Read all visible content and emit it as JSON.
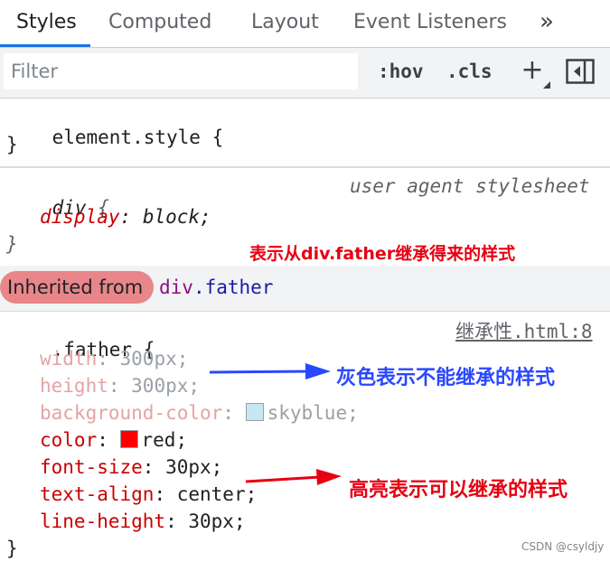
{
  "tabs": [
    {
      "label": "Styles",
      "active": true
    },
    {
      "label": "Computed",
      "active": false
    },
    {
      "label": "Layout",
      "active": false
    },
    {
      "label": "Event Listeners",
      "active": false
    }
  ],
  "more_tabs_icon": "»",
  "toolbar": {
    "filter_placeholder": "Filter",
    "hov_label": ":hov",
    "cls_label": ".cls",
    "new_rule_icon": "+",
    "toggle_sidebar_icon": "sidebar-toggle-icon"
  },
  "element_style": {
    "selector": "element.style",
    "open_brace": "{",
    "close_brace": "}"
  },
  "div_rule": {
    "selector": "div",
    "open_brace": "{",
    "source": "user agent stylesheet",
    "property": "display",
    "value": "block",
    "close_brace": "}"
  },
  "inherited": {
    "label": "Inherited from",
    "tag": "div",
    "class": ".father"
  },
  "father_rule": {
    "selector": ".father",
    "open_brace": "{",
    "source": "继承性.html:8",
    "close_brace": "}",
    "declarations": [
      {
        "property": "width",
        "value": "300px",
        "inherited": false
      },
      {
        "property": "height",
        "value": "300px",
        "inherited": false
      },
      {
        "property": "background-color",
        "value": "skyblue",
        "inherited": false,
        "swatch": "#c6e6f2"
      },
      {
        "property": "color",
        "value": "red",
        "inherited": true,
        "swatch": "#ff0000"
      },
      {
        "property": "font-size",
        "value": "30px",
        "inherited": true
      },
      {
        "property": "text-align",
        "value": "center",
        "inherited": true
      },
      {
        "property": "line-height",
        "value": "30px",
        "inherited": true
      }
    ]
  },
  "annotations": {
    "inherited_note": "表示从div.father继承得来的样式",
    "gray_note": "灰色表示不能继承的样式",
    "bright_note": "高亮表示可以继承的样式",
    "blue_color": "#2a48ff",
    "red_color": "#e60012"
  },
  "watermark": "CSDN @csyldjy"
}
